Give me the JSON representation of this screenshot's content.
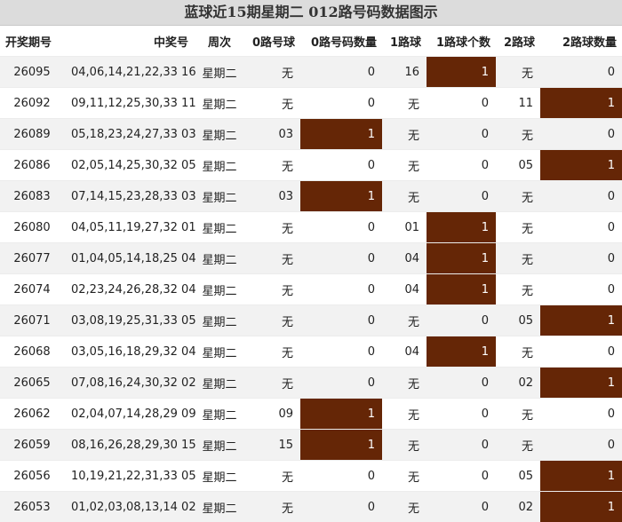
{
  "title": "蓝球近15期星期二 012路号码数据图示",
  "headers": [
    "开奖期号",
    "中奖号",
    "周次",
    "0路号球",
    "0路号码数量",
    "1路球",
    "1路球个数",
    "2路球",
    "2路球数量"
  ],
  "chart_data": {
    "type": "table",
    "title": "蓝球近15期星期二 012路号码数据图示",
    "columns": [
      "开奖期号",
      "中奖号",
      "周次",
      "0路号球",
      "0路号码数量",
      "1路球",
      "1路球个数",
      "2路球",
      "2路球数量"
    ],
    "rows": [
      {
        "issue": "26095",
        "nums": "04,06,14,21,22,33 16",
        "week": "星期二",
        "r0": "无",
        "c0": "0",
        "r1": "16",
        "c1": "1",
        "r2": "无",
        "c2": "0"
      },
      {
        "issue": "26092",
        "nums": "09,11,12,25,30,33 11",
        "week": "星期二",
        "r0": "无",
        "c0": "0",
        "r1": "无",
        "c1": "0",
        "r2": "11",
        "c2": "1"
      },
      {
        "issue": "26089",
        "nums": "05,18,23,24,27,33 03",
        "week": "星期二",
        "r0": "03",
        "c0": "1",
        "r1": "无",
        "c1": "0",
        "r2": "无",
        "c2": "0"
      },
      {
        "issue": "26086",
        "nums": "02,05,14,25,30,32 05",
        "week": "星期二",
        "r0": "无",
        "c0": "0",
        "r1": "无",
        "c1": "0",
        "r2": "05",
        "c2": "1"
      },
      {
        "issue": "26083",
        "nums": "07,14,15,23,28,33 03",
        "week": "星期二",
        "r0": "03",
        "c0": "1",
        "r1": "无",
        "c1": "0",
        "r2": "无",
        "c2": "0"
      },
      {
        "issue": "26080",
        "nums": "04,05,11,19,27,32 01",
        "week": "星期二",
        "r0": "无",
        "c0": "0",
        "r1": "01",
        "c1": "1",
        "r2": "无",
        "c2": "0"
      },
      {
        "issue": "26077",
        "nums": "01,04,05,14,18,25 04",
        "week": "星期二",
        "r0": "无",
        "c0": "0",
        "r1": "04",
        "c1": "1",
        "r2": "无",
        "c2": "0"
      },
      {
        "issue": "26074",
        "nums": "02,23,24,26,28,32 04",
        "week": "星期二",
        "r0": "无",
        "c0": "0",
        "r1": "04",
        "c1": "1",
        "r2": "无",
        "c2": "0"
      },
      {
        "issue": "26071",
        "nums": "03,08,19,25,31,33 05",
        "week": "星期二",
        "r0": "无",
        "c0": "0",
        "r1": "无",
        "c1": "0",
        "r2": "05",
        "c2": "1"
      },
      {
        "issue": "26068",
        "nums": "03,05,16,18,29,32 04",
        "week": "星期二",
        "r0": "无",
        "c0": "0",
        "r1": "04",
        "c1": "1",
        "r2": "无",
        "c2": "0"
      },
      {
        "issue": "26065",
        "nums": "07,08,16,24,30,32 02",
        "week": "星期二",
        "r0": "无",
        "c0": "0",
        "r1": "无",
        "c1": "0",
        "r2": "02",
        "c2": "1"
      },
      {
        "issue": "26062",
        "nums": "02,04,07,14,28,29 09",
        "week": "星期二",
        "r0": "09",
        "c0": "1",
        "r1": "无",
        "c1": "0",
        "r2": "无",
        "c2": "0"
      },
      {
        "issue": "26059",
        "nums": "08,16,26,28,29,30 15",
        "week": "星期二",
        "r0": "15",
        "c0": "1",
        "r1": "无",
        "c1": "0",
        "r2": "无",
        "c2": "0"
      },
      {
        "issue": "26056",
        "nums": "10,19,21,22,31,33 05",
        "week": "星期二",
        "r0": "无",
        "c0": "0",
        "r1": "无",
        "c1": "0",
        "r2": "05",
        "c2": "1"
      },
      {
        "issue": "26053",
        "nums": "01,02,03,08,13,14 02",
        "week": "星期二",
        "r0": "无",
        "c0": "0",
        "r1": "无",
        "c1": "0",
        "r2": "02",
        "c2": "1"
      }
    ]
  },
  "colors": {
    "highlight": "#652606",
    "count_cell": "#fcfce2",
    "title_bg": "#dcdcdc"
  }
}
